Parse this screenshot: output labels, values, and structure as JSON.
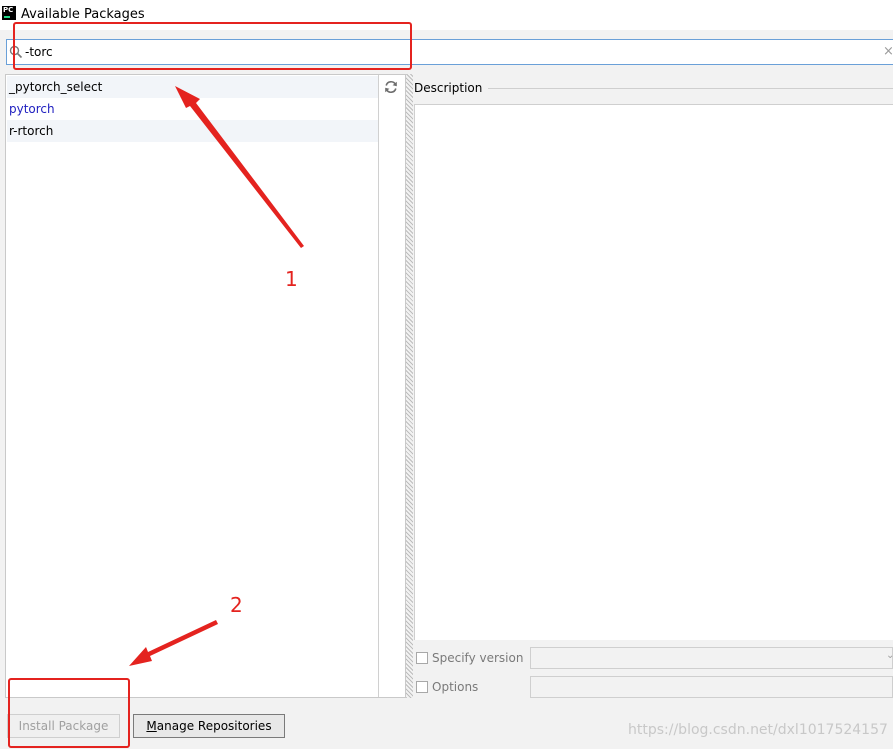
{
  "window": {
    "title": "Available Packages",
    "icon_text": "PC"
  },
  "search": {
    "value": "-torc",
    "placeholder": ""
  },
  "packages": [
    {
      "name": "_pytorch_select",
      "installed": false
    },
    {
      "name": "pytorch",
      "installed": true
    },
    {
      "name": "r-rtorch",
      "installed": false
    }
  ],
  "description": {
    "label": "Description"
  },
  "options": {
    "specify_version_label": "Specify version",
    "options_label": "Options"
  },
  "buttons": {
    "install_label": "Install Package",
    "manage_label_rest": "anage Repositories",
    "manage_label_mnemonic": "M"
  },
  "watermark": "https://blog.csdn.net/dxl1017524157",
  "annotations": {
    "step1": "1",
    "step2": "2"
  },
  "colors": {
    "annotation": "#e4231f",
    "installed_package": "#2020c0",
    "focus_border": "#6aa0d8"
  },
  "icons": {
    "search": "search-icon",
    "refresh": "refresh-icon",
    "clear": "close-icon",
    "dropdown": "chevron-down-icon"
  }
}
